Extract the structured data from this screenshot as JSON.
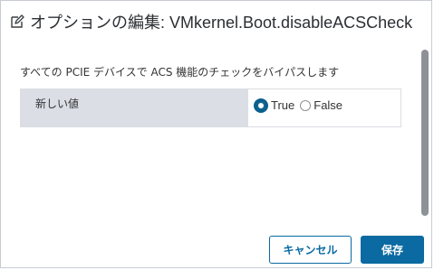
{
  "dialog": {
    "title": "オプションの編集: VMkernel.Boot.disableACSCheck",
    "description": "すべての PCIE デバイスで ACS 機能のチェックをバイパスします"
  },
  "setting": {
    "label": "新しい値",
    "options": [
      {
        "label": "True",
        "selected": true
      },
      {
        "label": "False",
        "selected": false
      }
    ]
  },
  "footer": {
    "cancel_label": "キャンセル",
    "save_label": "保存"
  },
  "icons": {
    "header": "edit-icon"
  },
  "colors": {
    "accent": "#0b6aa2",
    "row_label_bg": "#dcdee6",
    "scrollbar": "#8e9196"
  }
}
